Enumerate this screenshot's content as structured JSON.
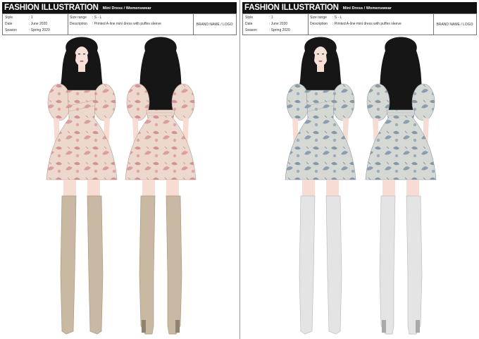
{
  "sheets": [
    {
      "title": "FASHION ILLUSTRATION",
      "subtitle": "Mini Dress  /  Womenswear",
      "style_label": "Style",
      "style_value": ": 1",
      "date_label": "Date",
      "date_value": ": June 2020",
      "season_label": "Season",
      "season_value": ": Spring 2020",
      "size_label": "Size range",
      "size_value": ": S - L",
      "desc_label": "Description",
      "desc_value": ": Printed A-line mini dress with puffes sleeve",
      "brand": "BRAND NAME / LOGO"
    },
    {
      "title": "FASHION ILLUSTRATION",
      "subtitle": "Mini Dress  /  Womenswear",
      "style_label": "Style",
      "style_value": ": 1",
      "date_label": "Date",
      "date_value": ": June 2020",
      "season_label": "Season",
      "season_value": ": Spring 2020",
      "size_label": "Size range",
      "size_value": ": S - L",
      "desc_label": "Description",
      "desc_value": ": Printed A-line mini dress with puffes sleeve",
      "brand": "BRAND NAME / LOGO"
    }
  ],
  "colorways": {
    "pink": {
      "dress": "#ecd8cc",
      "print": "#d9939a",
      "boot": "#c9b9a2",
      "boot_shade": "#a89a83"
    },
    "blue": {
      "dress": "#d6d8d4",
      "print": "#7e94a8",
      "boot": "#e4e4e4",
      "boot_shade": "#bdbdbd"
    }
  }
}
